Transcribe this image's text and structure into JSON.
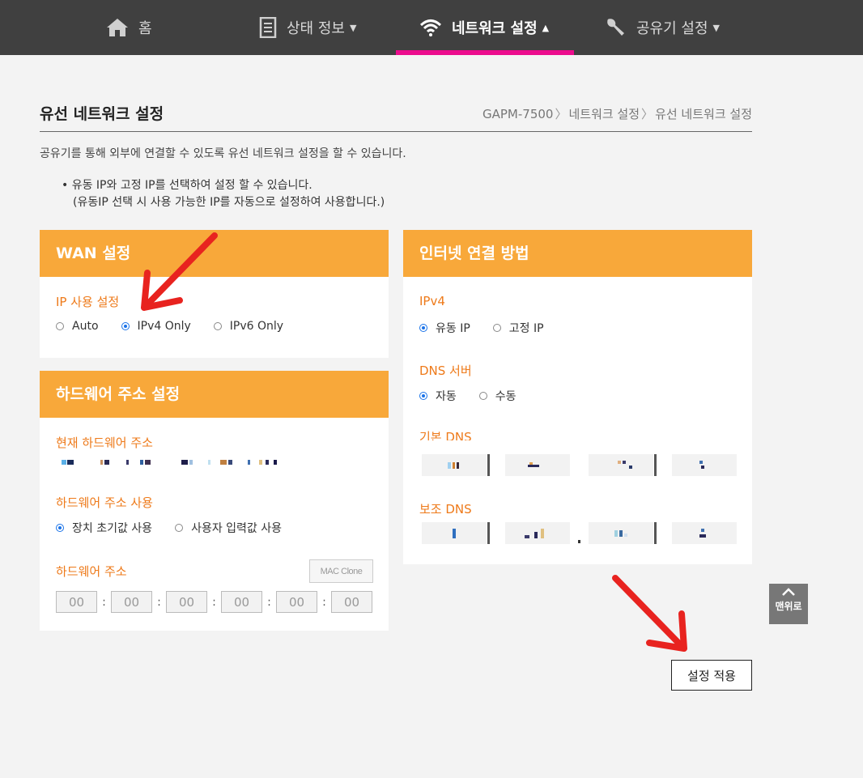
{
  "nav": {
    "items": [
      {
        "label": "홈",
        "icon": "home-icon",
        "caret": ""
      },
      {
        "label": "상태 정보",
        "icon": "document-icon",
        "caret": "▼"
      },
      {
        "label": "네트워크 설정",
        "icon": "wifi-icon",
        "caret": "▲",
        "active": true
      },
      {
        "label": "공유기 설정",
        "icon": "wrench-icon",
        "caret": "▼"
      }
    ],
    "active_underline_color": "#ec0b8d"
  },
  "page": {
    "title": "유선 네트워크 설정",
    "breadcrumb": [
      "GAPM-7500",
      "네트워크 설정",
      "유선 네트워크 설정"
    ],
    "breadcrumb_sep": "〉",
    "description": "공유기를 통해 외부에 연결할 수 있도록 유선 네트워크 설정을 할 수 있습니다.",
    "note_line1": "• 유동 IP와 고정 IP를 선택하여 설정 할 수 있습니다.",
    "note_line2": "(유동IP 선택 시 사용 가능한 IP를 자동으로 설정하여 사용합니다.)"
  },
  "wan": {
    "title": "WAN 설정",
    "ip_label": "IP 사용 설정",
    "options": [
      "Auto",
      "IPv4 Only",
      "IPv6 Only"
    ],
    "selected": "IPv4 Only"
  },
  "hw": {
    "title": "하드웨어 주소 설정",
    "current_label": "현재 하드웨어 주소",
    "use_label": "하드웨어 주소 사용",
    "use_options": [
      "장치 초기값 사용",
      "사용자 입력값 사용"
    ],
    "use_selected": "장치 초기값 사용",
    "address_label": "하드웨어 주소",
    "mac_clone_label": "MAC Clone",
    "octets": [
      "00",
      "00",
      "00",
      "00",
      "00",
      "00"
    ],
    "colon": ":"
  },
  "internet": {
    "title": "인터넷 연결 방법",
    "ipv4_label": "IPv4",
    "ipv4_options": [
      "유동 IP",
      "고정 IP"
    ],
    "ipv4_selected": "유동 IP",
    "dns_label": "DNS 서버",
    "dns_options": [
      "자동",
      "수동"
    ],
    "dns_selected": "자동",
    "primary_dns_label": "기본 DNS",
    "secondary_dns_label": "보조 DNS"
  },
  "scroll_top_label": "맨위로",
  "apply_label": "설정 적용",
  "colors": {
    "accent": "#f8a83a",
    "label": "#ee7a1a",
    "nav_bg": "#404040",
    "radio": "#1a73e8",
    "arrow": "#e8231f"
  }
}
